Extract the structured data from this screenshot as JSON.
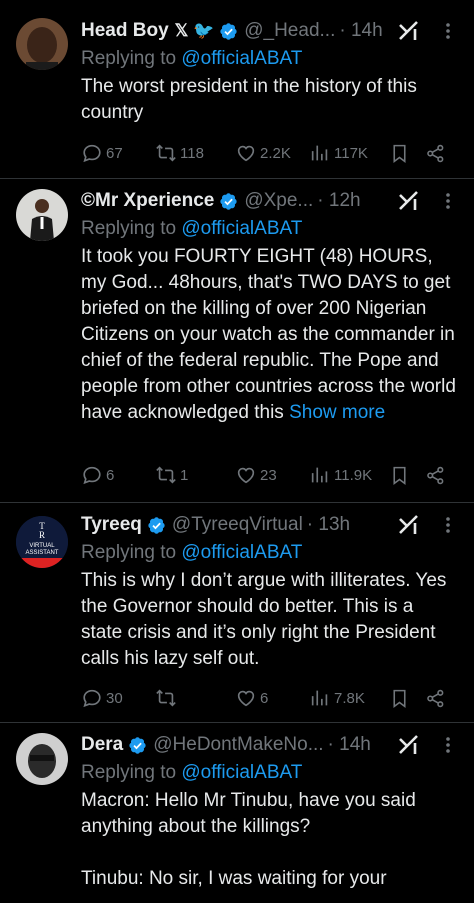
{
  "tweets": [
    {
      "name": "Head Boy",
      "name_emoji": "𝕏 🐦",
      "handle": "@_Head...",
      "time": "· 14h",
      "replying_prefix": "Replying to ",
      "replying_to": "@officialABAT",
      "text": "The worst president in the history of this country",
      "show_more": "",
      "replies": "67",
      "retweets": "118",
      "likes": "2.2K",
      "views": "117K"
    },
    {
      "name": "©Mr Xperience",
      "name_emoji": "",
      "handle": "@Xpe...",
      "time": "· 12h",
      "replying_prefix": "Replying to ",
      "replying_to": "@officialABAT",
      "text": "It took you FOURTY EIGHT (48) HOURS, my God... 48hours, that's TWO DAYS to get briefed on the killing of over 200 Nigerian Citizens on your watch as the commander in chief of the federal republic. The Pope and people from other countries across the world have acknowledged this ",
      "show_more": "Show more",
      "replies": "6",
      "retweets": "1",
      "likes": "23",
      "views": "11.9K"
    },
    {
      "name": "Tyreeq",
      "name_emoji": "",
      "handle": "@TyreeqVirtual",
      "time": "· 13h",
      "replying_prefix": "Replying to ",
      "replying_to": "@officialABAT",
      "text": "This is why I don’t argue with illiterates. Yes the Governor should do better. This is a state crisis and it’s only right the President calls his lazy self out.",
      "show_more": "",
      "replies": "30",
      "retweets": "",
      "likes": "6",
      "views": "7.8K",
      "avatar_text": [
        "T",
        "R",
        "VIRTUAL",
        "ASSISTANT"
      ]
    },
    {
      "name": "Dera",
      "name_emoji": "",
      "handle": "@HeDontMakeNo...",
      "time": "· 14h",
      "replying_prefix": "Replying to ",
      "replying_to": "@officialABAT",
      "text_line1": "Macron: Hello Mr Tinubu, have you said anything about the killings?",
      "text_line2": "Tinubu: No sir, I was waiting for your"
    }
  ],
  "icons": {
    "verified_color": "#1d9bf0",
    "text_primary": "#e7e9ea",
    "text_secondary": "#71767b",
    "link": "#1d9bf0"
  }
}
